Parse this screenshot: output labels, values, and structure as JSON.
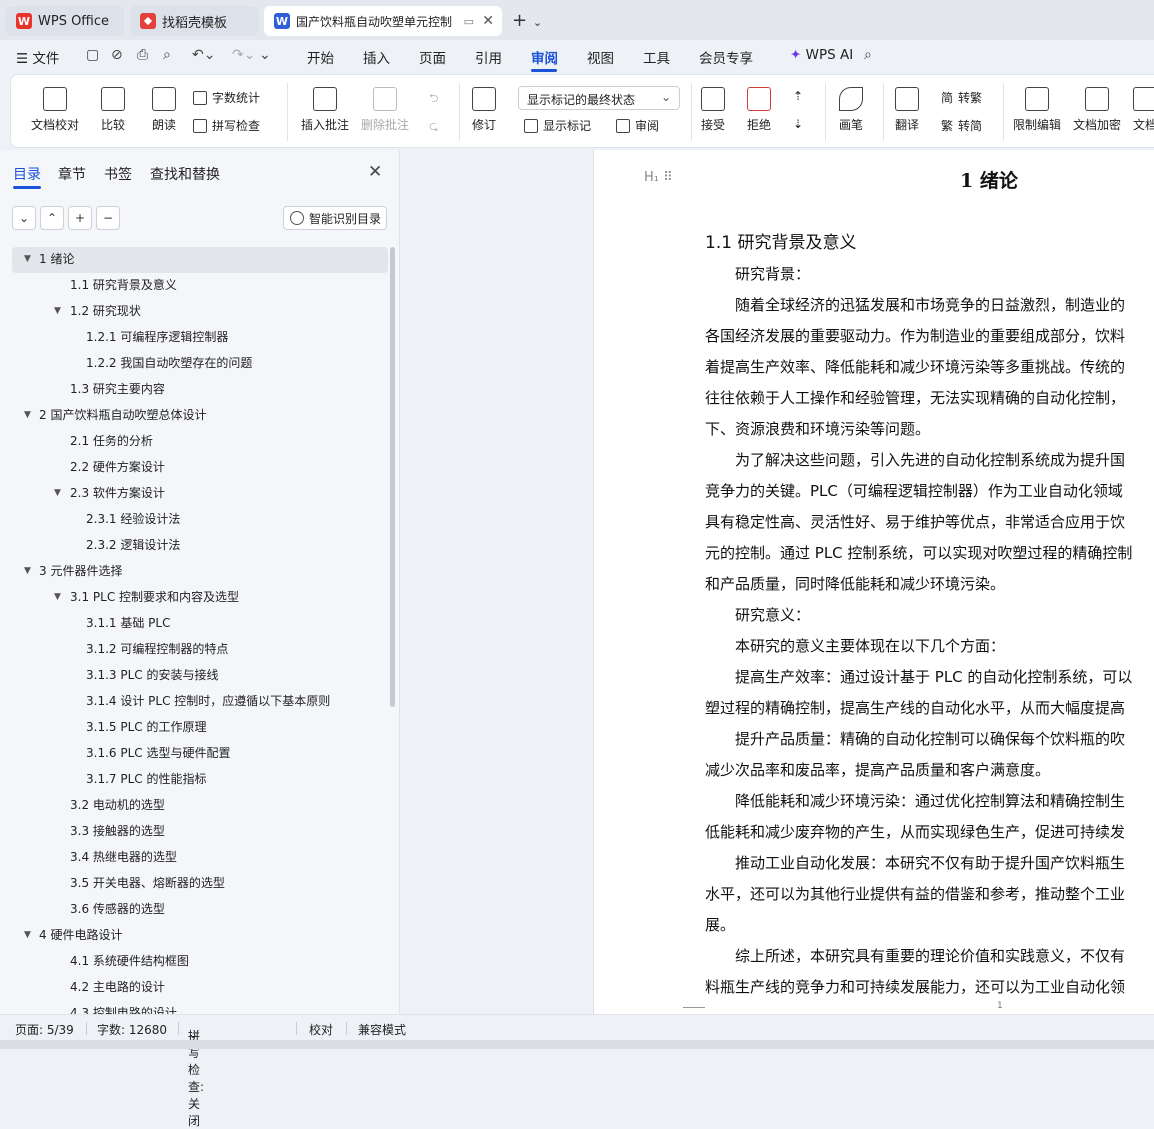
{
  "tabs": [
    {
      "label": "WPS Office"
    },
    {
      "label": "找稻壳模板"
    },
    {
      "label": "国产饮料瓶自动吹塑单元控制"
    }
  ],
  "menu": {
    "file": "文件",
    "items": [
      "开始",
      "插入",
      "页面",
      "引用",
      "审阅",
      "视图",
      "工具",
      "会员专享"
    ],
    "ai": "WPS AI"
  },
  "ribbon": {
    "doc_proof": "文档校对",
    "compare": "比较",
    "read": "朗读",
    "word_count": "字数统计",
    "spell_check": "拼写检查",
    "insert_comment": "插入批注",
    "delete_comment": "删除批注",
    "track": "修订",
    "display_state": "显示标记的最终状态",
    "show_markup": "显示标记",
    "review": "审阅",
    "accept": "接受",
    "reject": "拒绝",
    "pen": "画笔",
    "translate": "翻译",
    "to_trad": "转繁",
    "to_simp": "转简",
    "restrict": "限制编辑",
    "encrypt": "文档加密",
    "doc_more": "文档"
  },
  "sidebar": {
    "tabs": [
      "目录",
      "章节",
      "书签",
      "查找和替换"
    ],
    "smart_btn": "智能识别目录",
    "toc": [
      {
        "label": "1  绪论",
        "level": 1,
        "caret": "▼",
        "selected": true
      },
      {
        "label": "1.1 研究背景及意义",
        "level": 2,
        "caret": ""
      },
      {
        "label": "1.2 研究现状",
        "level": 2,
        "caret": "▼"
      },
      {
        "label": "1.2.1  可编程序逻辑控制器",
        "level": 3,
        "caret": ""
      },
      {
        "label": "1.2.2  我国自动吹塑存在的问题",
        "level": 3,
        "caret": ""
      },
      {
        "label": "1.3 研究主要内容",
        "level": 2,
        "caret": ""
      },
      {
        "label": "2  国产饮料瓶自动吹塑总体设计",
        "level": 1,
        "caret": "▼"
      },
      {
        "label": "2.1 任务的分析",
        "level": 2,
        "caret": ""
      },
      {
        "label": "2.2 硬件方案设计",
        "level": 2,
        "caret": ""
      },
      {
        "label": "2.3 软件方案设计",
        "level": 2,
        "caret": "▼"
      },
      {
        "label": "2.3.1 经验设计法",
        "level": 3,
        "caret": ""
      },
      {
        "label": "2.3.2 逻辑设计法",
        "level": 3,
        "caret": ""
      },
      {
        "label": "3  元件器件选择",
        "level": 1,
        "caret": "▼"
      },
      {
        "label": "3.1 PLC 控制要求和内容及选型",
        "level": 2,
        "caret": "▼"
      },
      {
        "label": "3.1.1 基础 PLC",
        "level": 3,
        "caret": ""
      },
      {
        "label": "3.1.2 可编程控制器的特点",
        "level": 3,
        "caret": ""
      },
      {
        "label": "3.1.3 PLC 的安装与接线",
        "level": 3,
        "caret": ""
      },
      {
        "label": "3.1.4 设计 PLC 控制时，应遵循以下基本原则",
        "level": 3,
        "caret": ""
      },
      {
        "label": "3.1.5 PLC 的工作原理",
        "level": 3,
        "caret": ""
      },
      {
        "label": "3.1.6 PLC 选型与硬件配置",
        "level": 3,
        "caret": ""
      },
      {
        "label": "3.1.7 PLC 的性能指标",
        "level": 3,
        "caret": ""
      },
      {
        "label": "3.2 电动机的选型",
        "level": 2,
        "caret": ""
      },
      {
        "label": "3.3 接触器的选型",
        "level": 2,
        "caret": ""
      },
      {
        "label": "3.4 热继电器的选型",
        "level": 2,
        "caret": ""
      },
      {
        "label": "3.5 开关电器、熔断器的选型",
        "level": 2,
        "caret": ""
      },
      {
        "label": "3.6 传感器的选型",
        "level": 2,
        "caret": ""
      },
      {
        "label": "4  硬件电路设计",
        "level": 1,
        "caret": "▼"
      },
      {
        "label": "4.1 系统硬件结构框图",
        "level": 2,
        "caret": ""
      },
      {
        "label": "4.2 主电路的设计",
        "level": 2,
        "caret": ""
      },
      {
        "label": "4.3 控制电路的设计",
        "level": 2,
        "caret": ""
      }
    ]
  },
  "document": {
    "heading1": "1  绪论",
    "heading2": "1.1 研究背景及意义",
    "lines": [
      "　　研究背景：",
      "　　随着全球经济的迅猛发展和市场竞争的日益激烈，制造业的",
      "各国经济发展的重要驱动力。作为制造业的重要组成部分，饮料",
      "着提高生产效率、降低能耗和减少环境污染等多重挑战。传统的",
      "往往依赖于人工操作和经验管理，无法实现精确的自动化控制，",
      "下、资源浪费和环境污染等问题。",
      "　　为了解决这些问题，引入先进的自动化控制系统成为提升国",
      "竞争力的关键。PLC（可编程逻辑控制器）作为工业自动化领域",
      "具有稳定性高、灵活性好、易于维护等优点，非常适合应用于饮",
      "元的控制。通过 PLC 控制系统，可以实现对吹塑过程的精确控制",
      "和产品质量，同时降低能耗和减少环境污染。",
      "　　研究意义：",
      "　　本研究的意义主要体现在以下几个方面：",
      "　　提高生产效率：通过设计基于 PLC 的自动化控制系统，可以",
      "塑过程的精确控制，提高生产线的自动化水平，从而大幅度提高",
      "　　提升产品质量：精确的自动化控制可以确保每个饮料瓶的吹",
      "减少次品率和废品率，提高产品质量和客户满意度。",
      "　　降低能耗和减少环境污染：通过优化控制算法和精确控制生",
      "低能耗和减少废弃物的产生，从而实现绿色生产，促进可持续发",
      "　　推动工业自动化发展：本研究不仅有助于提升国产饮料瓶生",
      "水平，还可以为其他行业提供有益的借鉴和参考，推动整个工业",
      "展。",
      "　　综上所述，本研究具有重要的理论价值和实践意义，不仅有",
      "料瓶生产线的竞争力和可持续发展能力，还可以为工业自动化领"
    ],
    "page_number": "1"
  },
  "status": {
    "page": "页面: 5/39",
    "words": "字数: 12680",
    "spell": "拼写检查: 关闭",
    "proof": "校对",
    "compat": "兼容模式"
  }
}
